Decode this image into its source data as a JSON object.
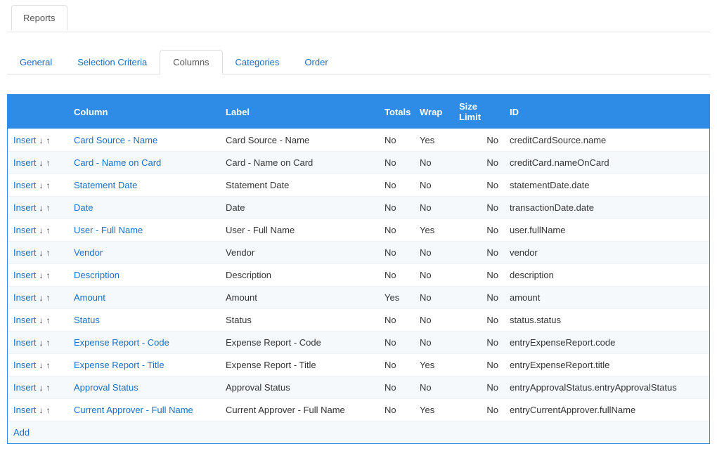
{
  "topTab": {
    "label": "Reports"
  },
  "subTabs": [
    {
      "label": "General",
      "active": false
    },
    {
      "label": "Selection Criteria",
      "active": false
    },
    {
      "label": "Columns",
      "active": true
    },
    {
      "label": "Categories",
      "active": false
    },
    {
      "label": "Order",
      "active": false
    }
  ],
  "columnsTable": {
    "headers": {
      "actions": "",
      "column": "Column",
      "label": "Label",
      "totals": "Totals",
      "wrap": "Wrap",
      "size": "Size Limit",
      "id": "ID"
    },
    "insertLabel": "Insert",
    "arrowDown": "↓",
    "arrowUp": "↑",
    "addLabel": "Add",
    "rows": [
      {
        "column": "Card Source - Name",
        "label": "Card Source - Name",
        "totals": "No",
        "wrap": "Yes",
        "sizeLimit": "No",
        "id": "creditCardSource.name"
      },
      {
        "column": "Card - Name on Card",
        "label": "Card - Name on Card",
        "totals": "No",
        "wrap": "No",
        "sizeLimit": "No",
        "id": "creditCard.nameOnCard"
      },
      {
        "column": "Statement Date",
        "label": "Statement Date",
        "totals": "No",
        "wrap": "No",
        "sizeLimit": "No",
        "id": "statementDate.date"
      },
      {
        "column": "Date",
        "label": "Date",
        "totals": "No",
        "wrap": "No",
        "sizeLimit": "No",
        "id": "transactionDate.date"
      },
      {
        "column": "User - Full Name",
        "label": "User - Full Name",
        "totals": "No",
        "wrap": "Yes",
        "sizeLimit": "No",
        "id": "user.fullName"
      },
      {
        "column": "Vendor",
        "label": "Vendor",
        "totals": "No",
        "wrap": "No",
        "sizeLimit": "No",
        "id": "vendor"
      },
      {
        "column": "Description",
        "label": "Description",
        "totals": "No",
        "wrap": "No",
        "sizeLimit": "No",
        "id": "description"
      },
      {
        "column": "Amount",
        "label": "Amount",
        "totals": "Yes",
        "wrap": "No",
        "sizeLimit": "No",
        "id": "amount"
      },
      {
        "column": "Status",
        "label": "Status",
        "totals": "No",
        "wrap": "No",
        "sizeLimit": "No",
        "id": "status.status"
      },
      {
        "column": "Expense Report - Code",
        "label": "Expense Report - Code",
        "totals": "No",
        "wrap": "No",
        "sizeLimit": "No",
        "id": "entryExpenseReport.code"
      },
      {
        "column": "Expense Report - Title",
        "label": "Expense Report - Title",
        "totals": "No",
        "wrap": "Yes",
        "sizeLimit": "No",
        "id": "entryExpenseReport.title"
      },
      {
        "column": "Approval Status",
        "label": "Approval Status",
        "totals": "No",
        "wrap": "No",
        "sizeLimit": "No",
        "id": "entryApprovalStatus.entryApprovalStatus"
      },
      {
        "column": "Current Approver - Full Name",
        "label": "Current Approver - Full Name",
        "totals": "No",
        "wrap": "Yes",
        "sizeLimit": "No",
        "id": "entryCurrentApprover.fullName"
      }
    ]
  }
}
